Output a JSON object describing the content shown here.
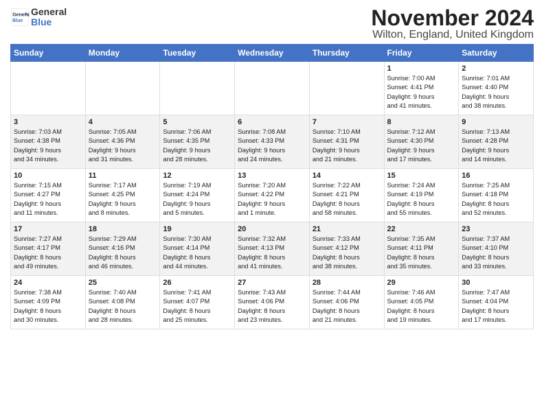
{
  "logo": {
    "line1": "General",
    "line2": "Blue"
  },
  "title": "November 2024",
  "subtitle": "Wilton, England, United Kingdom",
  "weekdays": [
    "Sunday",
    "Monday",
    "Tuesday",
    "Wednesday",
    "Thursday",
    "Friday",
    "Saturday"
  ],
  "weeks": [
    [
      {
        "day": "",
        "info": ""
      },
      {
        "day": "",
        "info": ""
      },
      {
        "day": "",
        "info": ""
      },
      {
        "day": "",
        "info": ""
      },
      {
        "day": "",
        "info": ""
      },
      {
        "day": "1",
        "info": "Sunrise: 7:00 AM\nSunset: 4:41 PM\nDaylight: 9 hours\nand 41 minutes."
      },
      {
        "day": "2",
        "info": "Sunrise: 7:01 AM\nSunset: 4:40 PM\nDaylight: 9 hours\nand 38 minutes."
      }
    ],
    [
      {
        "day": "3",
        "info": "Sunrise: 7:03 AM\nSunset: 4:38 PM\nDaylight: 9 hours\nand 34 minutes."
      },
      {
        "day": "4",
        "info": "Sunrise: 7:05 AM\nSunset: 4:36 PM\nDaylight: 9 hours\nand 31 minutes."
      },
      {
        "day": "5",
        "info": "Sunrise: 7:06 AM\nSunset: 4:35 PM\nDaylight: 9 hours\nand 28 minutes."
      },
      {
        "day": "6",
        "info": "Sunrise: 7:08 AM\nSunset: 4:33 PM\nDaylight: 9 hours\nand 24 minutes."
      },
      {
        "day": "7",
        "info": "Sunrise: 7:10 AM\nSunset: 4:31 PM\nDaylight: 9 hours\nand 21 minutes."
      },
      {
        "day": "8",
        "info": "Sunrise: 7:12 AM\nSunset: 4:30 PM\nDaylight: 9 hours\nand 17 minutes."
      },
      {
        "day": "9",
        "info": "Sunrise: 7:13 AM\nSunset: 4:28 PM\nDaylight: 9 hours\nand 14 minutes."
      }
    ],
    [
      {
        "day": "10",
        "info": "Sunrise: 7:15 AM\nSunset: 4:27 PM\nDaylight: 9 hours\nand 11 minutes."
      },
      {
        "day": "11",
        "info": "Sunrise: 7:17 AM\nSunset: 4:25 PM\nDaylight: 9 hours\nand 8 minutes."
      },
      {
        "day": "12",
        "info": "Sunrise: 7:19 AM\nSunset: 4:24 PM\nDaylight: 9 hours\nand 5 minutes."
      },
      {
        "day": "13",
        "info": "Sunrise: 7:20 AM\nSunset: 4:22 PM\nDaylight: 9 hours\nand 1 minute."
      },
      {
        "day": "14",
        "info": "Sunrise: 7:22 AM\nSunset: 4:21 PM\nDaylight: 8 hours\nand 58 minutes."
      },
      {
        "day": "15",
        "info": "Sunrise: 7:24 AM\nSunset: 4:19 PM\nDaylight: 8 hours\nand 55 minutes."
      },
      {
        "day": "16",
        "info": "Sunrise: 7:25 AM\nSunset: 4:18 PM\nDaylight: 8 hours\nand 52 minutes."
      }
    ],
    [
      {
        "day": "17",
        "info": "Sunrise: 7:27 AM\nSunset: 4:17 PM\nDaylight: 8 hours\nand 49 minutes."
      },
      {
        "day": "18",
        "info": "Sunrise: 7:29 AM\nSunset: 4:16 PM\nDaylight: 8 hours\nand 46 minutes."
      },
      {
        "day": "19",
        "info": "Sunrise: 7:30 AM\nSunset: 4:14 PM\nDaylight: 8 hours\nand 44 minutes."
      },
      {
        "day": "20",
        "info": "Sunrise: 7:32 AM\nSunset: 4:13 PM\nDaylight: 8 hours\nand 41 minutes."
      },
      {
        "day": "21",
        "info": "Sunrise: 7:33 AM\nSunset: 4:12 PM\nDaylight: 8 hours\nand 38 minutes."
      },
      {
        "day": "22",
        "info": "Sunrise: 7:35 AM\nSunset: 4:11 PM\nDaylight: 8 hours\nand 35 minutes."
      },
      {
        "day": "23",
        "info": "Sunrise: 7:37 AM\nSunset: 4:10 PM\nDaylight: 8 hours\nand 33 minutes."
      }
    ],
    [
      {
        "day": "24",
        "info": "Sunrise: 7:38 AM\nSunset: 4:09 PM\nDaylight: 8 hours\nand 30 minutes."
      },
      {
        "day": "25",
        "info": "Sunrise: 7:40 AM\nSunset: 4:08 PM\nDaylight: 8 hours\nand 28 minutes."
      },
      {
        "day": "26",
        "info": "Sunrise: 7:41 AM\nSunset: 4:07 PM\nDaylight: 8 hours\nand 25 minutes."
      },
      {
        "day": "27",
        "info": "Sunrise: 7:43 AM\nSunset: 4:06 PM\nDaylight: 8 hours\nand 23 minutes."
      },
      {
        "day": "28",
        "info": "Sunrise: 7:44 AM\nSunset: 4:06 PM\nDaylight: 8 hours\nand 21 minutes."
      },
      {
        "day": "29",
        "info": "Sunrise: 7:46 AM\nSunset: 4:05 PM\nDaylight: 8 hours\nand 19 minutes."
      },
      {
        "day": "30",
        "info": "Sunrise: 7:47 AM\nSunset: 4:04 PM\nDaylight: 8 hours\nand 17 minutes."
      }
    ]
  ]
}
